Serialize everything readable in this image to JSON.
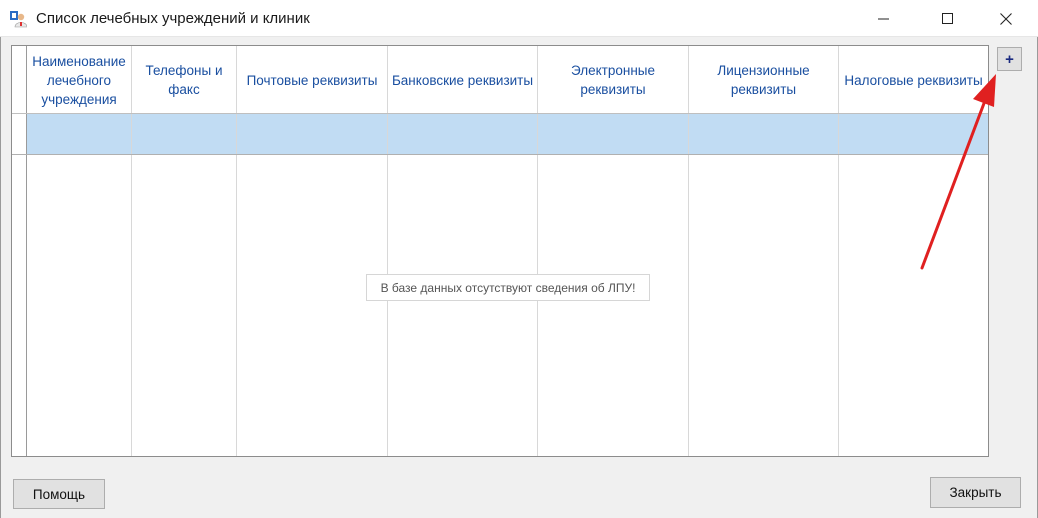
{
  "window": {
    "title": "Список лечебных учреждений и клиник",
    "controls": {
      "minimize_icon": "minimize-icon",
      "maximize_icon": "maximize-icon",
      "close_icon": "close-icon"
    }
  },
  "grid": {
    "columns": [
      "Наименование лечебного учреждения",
      "Телефоны и факс",
      "Почтовые реквизиты",
      "Банковские реквизиты",
      "Электронные реквизиты",
      "Лицензионные реквизиты",
      "Налоговые реквизиты"
    ],
    "empty_message": "В базе данных отсутствуют сведения об ЛПУ!",
    "header_text_color": "#1a4fa0",
    "selected_row_color": "#c1dcf3"
  },
  "toolbar": {
    "add_label": "+"
  },
  "annotation": {
    "arrow_color": "#e02020"
  },
  "footer": {
    "help_label": "Помощь",
    "close_label": "Закрыть"
  }
}
